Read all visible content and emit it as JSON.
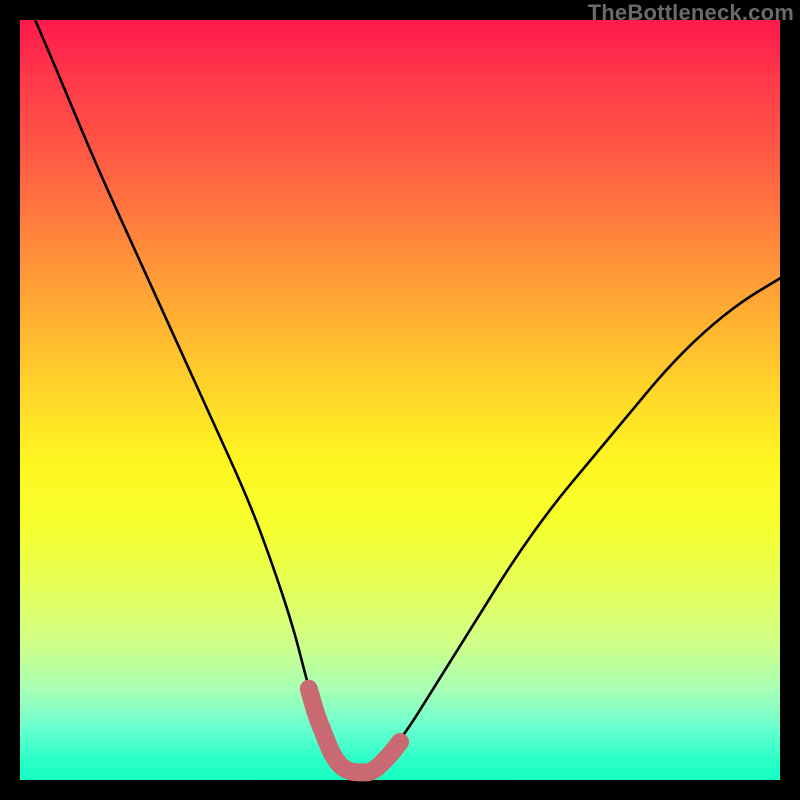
{
  "watermark": "TheBottleneck.com",
  "chart_data": {
    "type": "line",
    "title": "",
    "xlabel": "",
    "ylabel": "",
    "xlim": [
      0,
      100
    ],
    "ylim": [
      0,
      100
    ],
    "series": [
      {
        "name": "bottleneck-curve",
        "color": "#000000",
        "x": [
          2,
          5,
          10,
          15,
          20,
          25,
          30,
          33,
          36,
          38,
          40,
          42,
          44,
          46,
          50,
          55,
          60,
          65,
          70,
          75,
          80,
          85,
          90,
          95,
          100
        ],
        "values": [
          100,
          93,
          81,
          70,
          59,
          48,
          37,
          29,
          20,
          12,
          6,
          2,
          1,
          1,
          5,
          13,
          21,
          29,
          36,
          42,
          48,
          54,
          59,
          63,
          66
        ]
      },
      {
        "name": "optimal-zone-highlight",
        "color": "#c96a72",
        "x": [
          38,
          39,
          40,
          41,
          42,
          43,
          44,
          45,
          46,
          47,
          48,
          49,
          50
        ],
        "values": [
          12,
          8.5,
          6,
          3.5,
          2,
          1.3,
          1,
          1,
          1,
          1.6,
          2.6,
          3.7,
          5
        ]
      }
    ]
  }
}
